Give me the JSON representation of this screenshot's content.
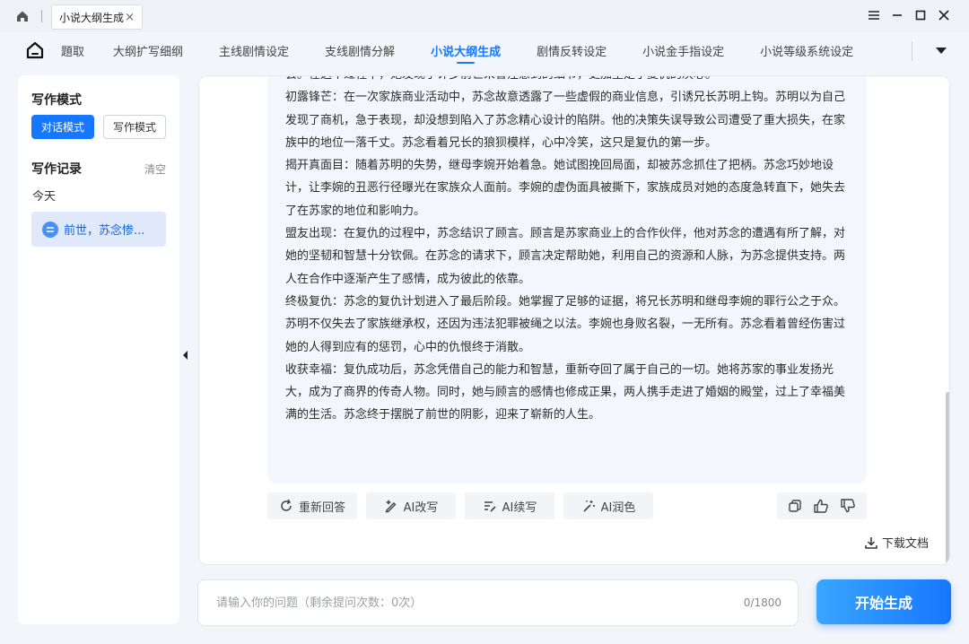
{
  "window": {
    "tab_title": "小说大纲生成",
    "tab_close": "×"
  },
  "nav": {
    "items": [
      "題取",
      "大纲扩写细纲",
      "主线剧情设定",
      "支线剧情分解",
      "小说大纲生成",
      "剧情反转设定",
      "小说金手指设定",
      "小说等级系统设定"
    ],
    "active": "小说大纲生成"
  },
  "sidebar": {
    "mode_heading": "写作模式",
    "mode_chat": "对话模式",
    "mode_write": "写作模式",
    "records_heading": "写作记录",
    "clear": "清空",
    "today": "今天",
    "record_item": "前世，苏念惨..."
  },
  "message": {
    "paragraphs": [
      "会。在这个过程中，她发现了许多前世未曾注意到的细节，更加坚定了复仇的决心。",
      "初露锋芒：在一次家族商业活动中，苏念故意透露了一些虚假的商业信息，引诱兄长苏明上钩。苏明以为自己发现了商机，急于表现，却没想到陷入了苏念精心设计的陷阱。他的决策失误导致公司遭受了重大损失，在家族中的地位一落千丈。苏念看着兄长的狼狈模样，心中冷笑，这只是复仇的第一步。",
      "揭开真面目：随着苏明的失势，继母李婉开始着急。她试图挽回局面，却被苏念抓住了把柄。苏念巧妙地设计，让李婉的丑恶行径曝光在家族众人面前。李婉的虚伪面具被撕下，家族成员对她的态度急转直下，她失去了在苏家的地位和影响力。",
      "盟友出现：在复仇的过程中，苏念结识了顾言。顾言是苏家商业上的合作伙伴，他对苏念的遭遇有所了解，对她的坚韧和智慧十分钦佩。在苏念的请求下，顾言决定帮助她，利用自己的资源和人脉，为苏念提供支持。两人在合作中逐渐产生了感情，成为彼此的依靠。",
      "终极复仇：苏念的复仇计划进入了最后阶段。她掌握了足够的证据，将兄长苏明和继母李婉的罪行公之于众。苏明不仅失去了家族继承权，还因为违法犯罪被绳之以法。李婉也身败名裂，一无所有。苏念看着曾经伤害过她的人得到应有的惩罚，心中的仇恨终于消散。",
      "收获幸福：复仇成功后，苏念凭借自己的能力和智慧，重新夺回了属于自己的一切。她将苏家的事业发扬光大，成为了商界的传奇人物。同时，她与顾言的感情也修成正果，两人携手走进了婚姻的殿堂，过上了幸福美满的生活。苏念终于摆脱了前世的阴影，迎来了崭新的人生。"
    ]
  },
  "actions": {
    "regenerate": "重新回答",
    "ai_rewrite": "AI改写",
    "ai_continue": "AI续写",
    "ai_polish": "AI润色",
    "download": "下载文档"
  },
  "input": {
    "placeholder": "请输入你的问题（剩余提问次数：0次）",
    "char_count": "0/1800",
    "generate_label": "开始生成"
  }
}
